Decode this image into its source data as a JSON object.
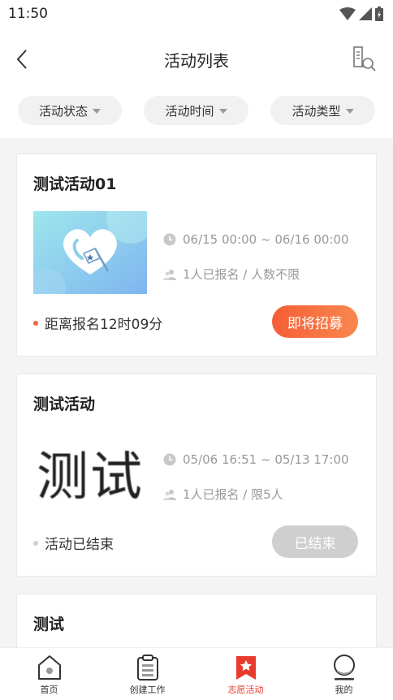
{
  "status_bar": {
    "time": "11:50"
  },
  "header": {
    "title": "活动列表"
  },
  "filters": [
    {
      "label": "活动状态"
    },
    {
      "label": "活动时间"
    },
    {
      "label": "活动类型"
    }
  ],
  "activities": [
    {
      "title": "测试活动01",
      "thumb": "heart-flag-image",
      "time": "06/15 00:00 ~ 06/16 00:00",
      "signup": "1人已报名 / 人数不限",
      "status_text": "距离报名12时09分",
      "button": "即将招募"
    },
    {
      "title": "测试活动",
      "thumb_text": "测试",
      "time": "05/06 16:51 ~ 05/13 17:00",
      "signup": "1人已报名 / 限5人",
      "status_text": "活动已结束",
      "button": "已结束"
    },
    {
      "title": "测试"
    }
  ],
  "tabbar": [
    {
      "label": "首页",
      "icon": "home-icon"
    },
    {
      "label": "创建工作",
      "icon": "clipboard-icon"
    },
    {
      "label": "志愿活动",
      "icon": "star-bookmark-icon",
      "active": true
    },
    {
      "label": "我的",
      "icon": "user-icon"
    }
  ],
  "colors": {
    "accent": "#e83b2e",
    "orange_btn": "#f7693a",
    "disabled_btn": "#cfcfcf"
  }
}
